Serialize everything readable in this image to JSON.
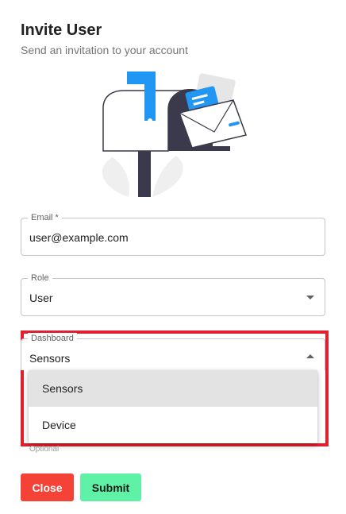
{
  "dialog": {
    "title": "Invite User",
    "subtitle": "Send an invitation to your account"
  },
  "form": {
    "email": {
      "label": "Email *",
      "value": "user@example.com"
    },
    "role": {
      "label": "Role",
      "value": "User"
    },
    "dashboard": {
      "label": "Dashboard",
      "value": "Sensors",
      "options": [
        "Sensors",
        "Device"
      ],
      "helper_text": "Optional"
    }
  },
  "buttons": {
    "close_label": "Close",
    "submit_label": "Submit"
  },
  "colors": {
    "close": "#f44336",
    "submit": "#5ff2a6",
    "highlight": "#e0202f",
    "illustration_accent": "#2196f3",
    "illustration_dark": "#3a3a4c"
  },
  "icons": {
    "illustration": "mailbox-illustration",
    "caret": "arrow-drop-down-icon"
  }
}
